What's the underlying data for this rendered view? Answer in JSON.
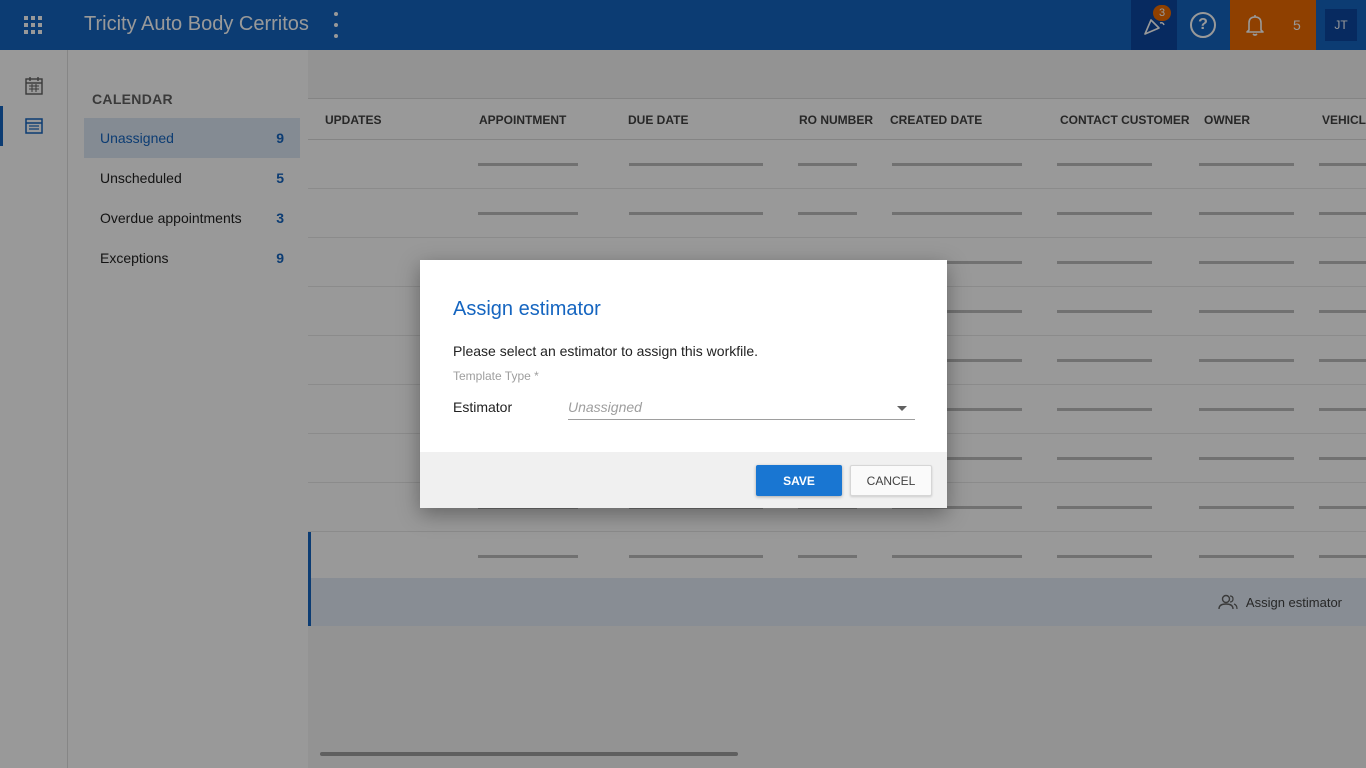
{
  "header": {
    "app_title": "Tricity Auto Body Cerritos",
    "updates_badge": "3",
    "help_label": "?",
    "notifications_count": "5",
    "user_initials": "JT",
    "colors": {
      "bar": "#1565c0",
      "accent_orange": "#ef6c00"
    }
  },
  "rail": {
    "items": [
      {
        "icon": "calendar-icon"
      },
      {
        "icon": "list-icon",
        "active": true
      }
    ]
  },
  "subnav": {
    "title": "CALENDAR",
    "items": [
      {
        "label": "Unassigned",
        "count": "9",
        "active": true
      },
      {
        "label": "Unscheduled",
        "count": "5"
      },
      {
        "label": "Overdue appointments",
        "count": "3"
      },
      {
        "label": "Exceptions",
        "count": "9"
      }
    ]
  },
  "table": {
    "columns": [
      "UPDATES",
      "APPOINTMENT",
      "DUE DATE",
      "RO NUMBER",
      "CREATED DATE",
      "CONTACT CUSTOMER",
      "OWNER",
      "VEHICLE"
    ]
  },
  "action_bar": {
    "assign_label": "Assign estimator"
  },
  "dialog": {
    "title": "Assign estimator",
    "description": "Please select an estimator to assign this workfile.",
    "field_caption": "Template Type *",
    "estimator_label": "Estimator",
    "estimator_value": "Unassigned",
    "save_label": "SAVE",
    "cancel_label": "CANCEL"
  }
}
